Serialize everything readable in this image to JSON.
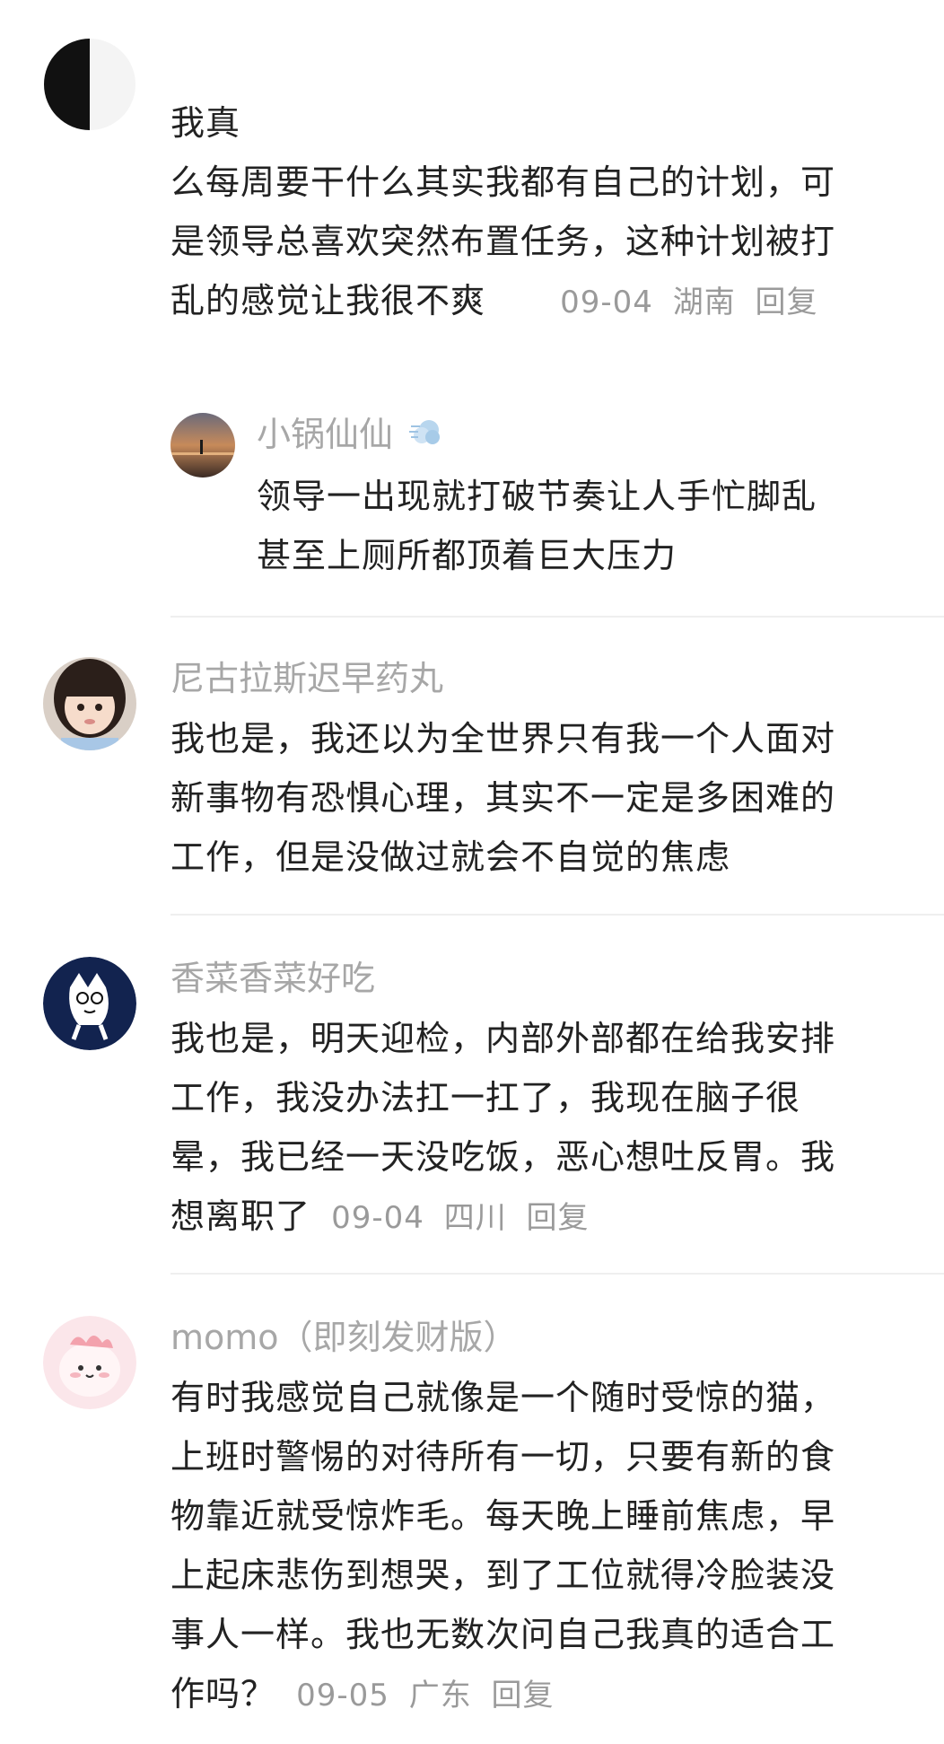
{
  "comments": [
    {
      "username": "",
      "text": "我真\n么每周要干什么其实我都有自己的计划，可是领导总喜欢突然布置任务，这种计划被打乱的感觉让我很不爽",
      "meta": {
        "date": "09-04",
        "location": "湖南",
        "reply": "回复"
      },
      "replies": [
        {
          "username": "小锅仙仙",
          "text": "领导一出现就打破节奏让人手忙脚乱甚至上厕所都顶着巨大压力"
        }
      ]
    },
    {
      "username": "尼古拉斯迟早药丸",
      "text": "我也是，我还以为全世界只有我一个人面对新事物有恐惧心理，其实不一定是多困难的工作，但是没做过就会不自觉的焦虑",
      "meta": null
    },
    {
      "username": "香菜香菜好吃",
      "text": "我也是，明天迎检，内部外部都在给我安排工作，我没办法扛一扛了，我现在脑子很晕，我已经一天没吃饭，恶心想吐反胃。我想离职了",
      "meta": {
        "date": "09-04",
        "location": "四川",
        "reply": "回复"
      }
    },
    {
      "username": "momo（即刻发财版）",
      "text": "有时我感觉自己就像是一个随时受惊的猫，上班时警惕的对待所有一切，只要有新的食物靠近就受惊炸毛。每天晚上睡前焦虑，早上起床悲伤到想哭，到了工位就得冷脸装没事人一样。我也无数次问自己我真的适合工作吗？",
      "meta": {
        "date": "09-05",
        "location": "广东",
        "reply": "回复"
      }
    }
  ],
  "icons": {
    "reply_emoji": "dash-emoji-icon"
  }
}
